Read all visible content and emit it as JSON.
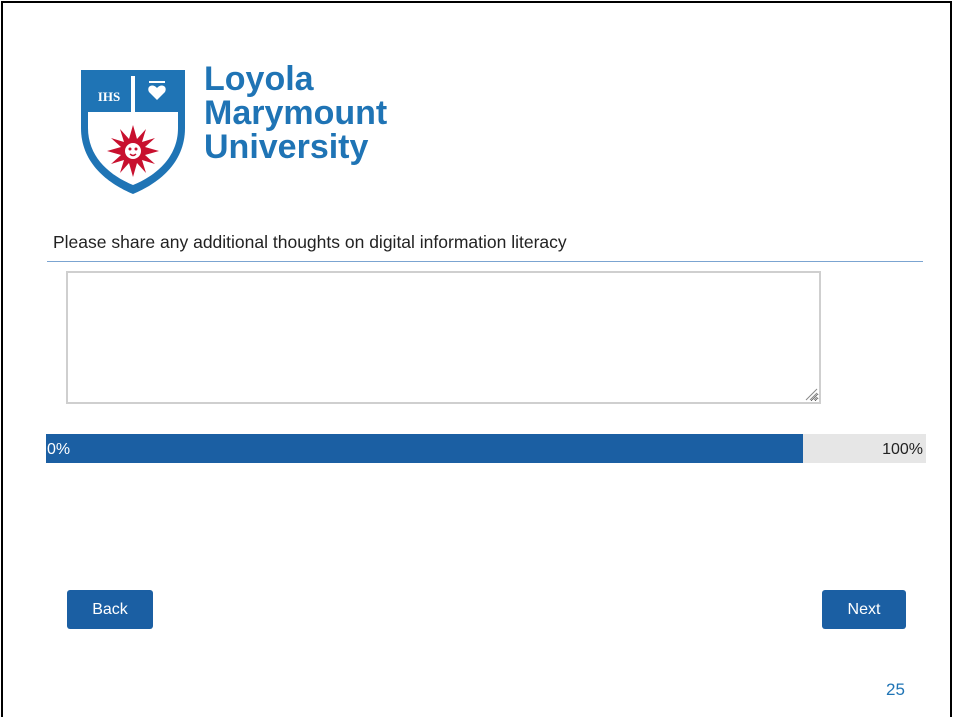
{
  "logo": {
    "line1": "Loyola",
    "line2": "Marymount",
    "line3": "University",
    "shield_monogram": "IHS",
    "brand_color": "#1f74b5",
    "crest_color": "#c8102e"
  },
  "question": {
    "text": "Please share any additional thoughts on digital information literacy"
  },
  "answer": {
    "value": ""
  },
  "progress": {
    "percent": 86,
    "start_label": "0%",
    "end_label": "100%",
    "fill_color": "#1b5fa3"
  },
  "nav": {
    "back_label": "Back",
    "next_label": "Next"
  },
  "slide": {
    "page_number": "25"
  }
}
